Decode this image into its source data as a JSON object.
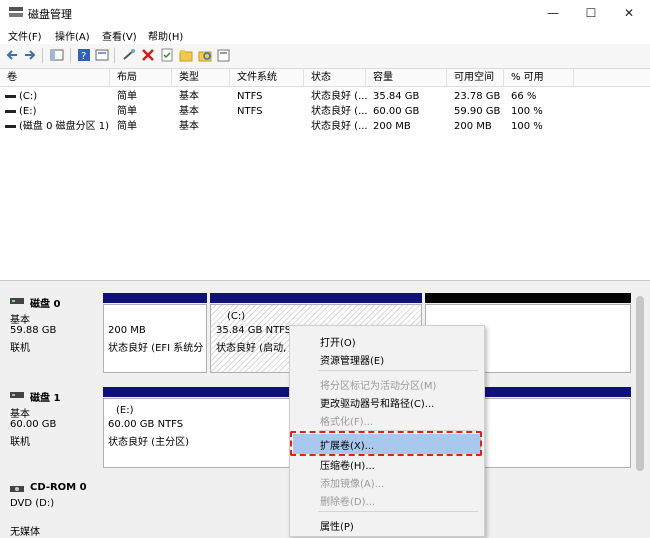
{
  "window": {
    "title": "磁盘管理",
    "minimize": "—",
    "maximize": "☐",
    "close": "✕"
  },
  "menus": [
    "文件(F)",
    "操作(A)",
    "查看(V)",
    "帮助(H)"
  ],
  "toolbar": {
    "icons": [
      "back-icon",
      "forward-icon",
      "console-tree-icon",
      "help-icon",
      "properties-icon",
      "connect-icon",
      "delete-icon",
      "check-icon",
      "folder-icon",
      "refresh-icon",
      "disk-icon"
    ]
  },
  "volume_table": {
    "headers": [
      "卷",
      "布局",
      "类型",
      "文件系统",
      "状态",
      "容量",
      "可用空间",
      "% 可用"
    ],
    "rows": [
      [
        "(C:)",
        "简单",
        "基本",
        "NTFS",
        "状态良好 (...",
        "35.84 GB",
        "23.78 GB",
        "66 %"
      ],
      [
        "(E:)",
        "简单",
        "基本",
        "NTFS",
        "状态良好 (...",
        "60.00 GB",
        "59.90 GB",
        "100 %"
      ],
      [
        "(磁盘 0 磁盘分区 1)",
        "简单",
        "基本",
        "",
        "状态良好 (...",
        "200 MB",
        "200 MB",
        "100 %"
      ]
    ]
  },
  "disks": [
    {
      "name": "磁盘 0",
      "type": "基本",
      "size": "59.88 GB",
      "status": "联机",
      "partitions": [
        {
          "label": "",
          "line1": "200 MB",
          "line2": "状态良好 (EFI 系统分"
        },
        {
          "label": "(C:)",
          "line1": "35.84 GB NTFS",
          "line2": "状态良好 (启动, 页"
        },
        {
          "label": "",
          "line1": "",
          "line2": ""
        }
      ]
    },
    {
      "name": "磁盘 1",
      "type": "基本",
      "size": "60.00 GB",
      "status": "联机",
      "partitions": [
        {
          "label": "(E:)",
          "line1": "60.00 GB NTFS",
          "line2": "状态良好 (主分区)"
        }
      ]
    },
    {
      "name": "CD-ROM 0",
      "type": "DVD (D:)",
      "size": "",
      "status": "无媒体"
    }
  ],
  "context_menu": {
    "items": [
      {
        "label": "打开(O)",
        "enabled": true
      },
      {
        "label": "资源管理器(E)",
        "enabled": true
      },
      {
        "label": "将分区标记为活动分区(M)",
        "enabled": false
      },
      {
        "label": "更改驱动器号和路径(C)...",
        "enabled": true
      },
      {
        "label": "格式化(F)...",
        "enabled": false
      },
      {
        "label": "扩展卷(X)...",
        "enabled": true,
        "highlighted": true
      },
      {
        "label": "压缩卷(H)...",
        "enabled": true
      },
      {
        "label": "添加镜像(A)...",
        "enabled": false
      },
      {
        "label": "删除卷(D)...",
        "enabled": false
      },
      {
        "label": "属性(P)",
        "enabled": true
      }
    ]
  },
  "colors": {
    "disk_stripe": "#10107a",
    "unallocated_stripe": "#000000",
    "highlight": "#a9c8ee",
    "annotation_border": "#e0201a"
  }
}
